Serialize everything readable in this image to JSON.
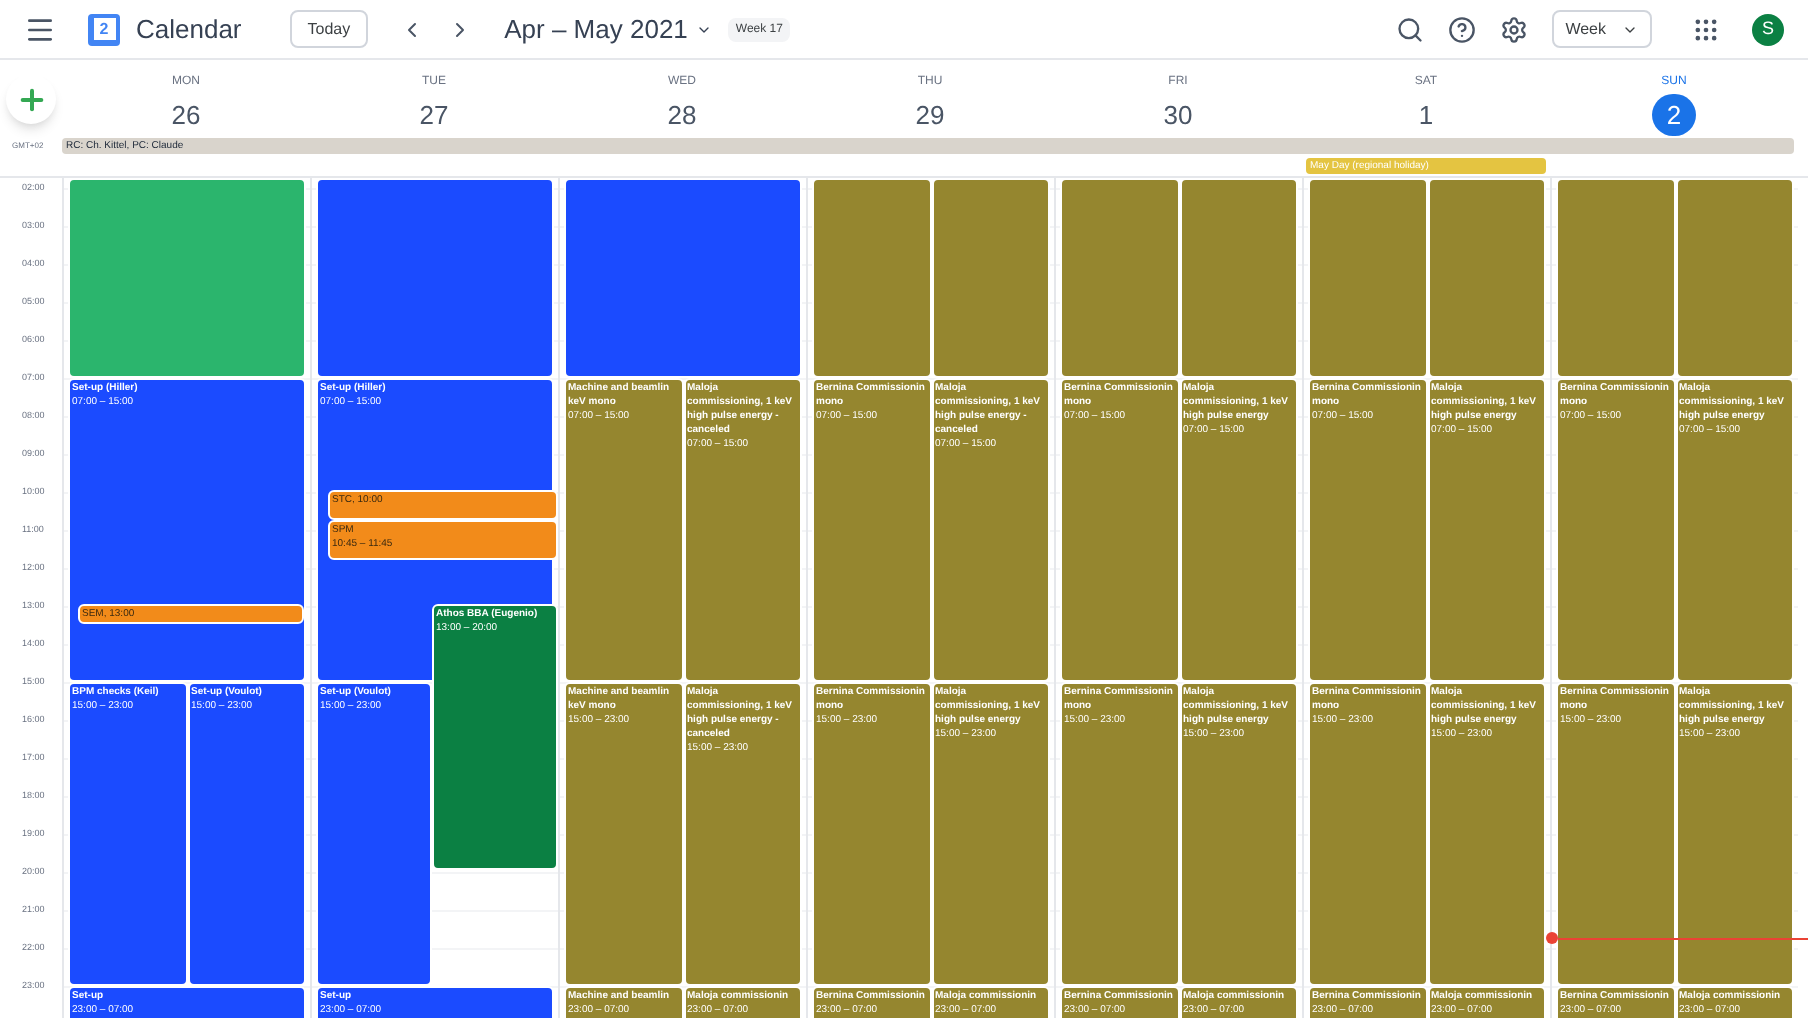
{
  "app": {
    "logo_digit": "2",
    "title": "Calendar"
  },
  "toolbar": {
    "today": "Today",
    "range": "Apr – May 2021",
    "week_badge": "Week 17",
    "view": "Week",
    "avatar": "S"
  },
  "timezone": "GMT+02",
  "days": [
    {
      "dow": "MON",
      "date": "26",
      "selected": false
    },
    {
      "dow": "TUE",
      "date": "27",
      "selected": false
    },
    {
      "dow": "WED",
      "date": "28",
      "selected": false
    },
    {
      "dow": "THU",
      "date": "29",
      "selected": false
    },
    {
      "dow": "FRI",
      "date": "30",
      "selected": false
    },
    {
      "dow": "SAT",
      "date": "1",
      "selected": false,
      "holiday": {
        "title": "May Day (regional holiday)",
        "color": "#e4c441"
      }
    },
    {
      "dow": "SUN",
      "date": "2",
      "selected": true
    }
  ],
  "all_day_banner": "RC: Ch. Kittel, PC: Claude",
  "hours": [
    "02:00",
    "03:00",
    "04:00",
    "05:00",
    "06:00",
    "07:00",
    "08:00",
    "09:00",
    "10:00",
    "11:00",
    "12:00",
    "13:00",
    "14:00",
    "15:00",
    "16:00",
    "17:00",
    "18:00",
    "19:00",
    "20:00",
    "21:00",
    "22:00",
    "23:00"
  ],
  "events": [
    [
      {
        "kind": "early",
        "color": "#2bb56d"
      },
      {
        "kind": "morning",
        "color": "#1b4bff",
        "lines": [
          "Set-up (Hiller)"
        ],
        "time": "07:00 – 15:00"
      },
      {
        "kind": "sem",
        "color": "#f28b1a",
        "lines": [
          "SEM, 13:00"
        ]
      },
      {
        "kind": "afternoon-left",
        "color": "#1b4bff",
        "lines": [
          "BPM checks (Keil)"
        ],
        "time": "15:00 – 23:00"
      },
      {
        "kind": "afternoon-right",
        "color": "#1b4bff",
        "lines": [
          "Set-up (Voulot)"
        ],
        "time": "15:00 – 23:00"
      },
      {
        "kind": "night",
        "color": "#1b4bff",
        "lines": [
          "Set-up"
        ],
        "time": "23:00 – 07:00"
      }
    ],
    [
      {
        "kind": "early",
        "color": "#1b4bff"
      },
      {
        "kind": "morning",
        "color": "#1b4bff",
        "lines": [
          "Set-up (Hiller)"
        ],
        "time": "07:00 – 15:00"
      },
      {
        "kind": "stc",
        "color": "#f28b1a",
        "lines": [
          "STC, 10:00"
        ]
      },
      {
        "kind": "spm",
        "color": "#f28b1a",
        "lines": [
          "SPM"
        ],
        "time": "10:45 – 11:45"
      },
      {
        "kind": "afternoon-narrow",
        "color": "#1b4bff",
        "lines": [
          "Set-up (Voulot)"
        ],
        "time": "15:00 – 23:00"
      },
      {
        "kind": "athos",
        "color": "#0b8043",
        "lines": [
          "Athos BBA (Eugenio)"
        ],
        "time": "13:00 – 20:00"
      },
      {
        "kind": "night",
        "color": "#1b4bff",
        "lines": [
          "Set-up"
        ],
        "time": "23:00 – 07:00"
      }
    ],
    [
      {
        "kind": "early",
        "color": "#1b4bff"
      },
      {
        "kind": "morning-left",
        "color": "#95862f",
        "lines": [
          "Machine and beamlin",
          "keV mono"
        ],
        "time": "07:00 – 15:00"
      },
      {
        "kind": "morning-right",
        "color": "#95862f",
        "lines": [
          "Maloja",
          "commissioning, 1 keV",
          "high pulse energy -",
          "canceled"
        ],
        "time": "07:00 – 15:00"
      },
      {
        "kind": "afternoon-left",
        "color": "#95862f",
        "lines": [
          "Machine and beamlin",
          "keV mono"
        ],
        "time": "15:00 – 23:00"
      },
      {
        "kind": "afternoon-right",
        "color": "#95862f",
        "lines": [
          "Maloja",
          "commissioning, 1 keV",
          "high pulse energy -",
          "canceled"
        ],
        "time": "15:00 – 23:00"
      },
      {
        "kind": "night-left",
        "color": "#95862f",
        "lines": [
          "Machine and beamlin"
        ],
        "time": "23:00 – 07:00"
      },
      {
        "kind": "night-right",
        "color": "#95862f",
        "lines": [
          "Maloja commissionin"
        ],
        "time": "23:00 – 07:00"
      }
    ],
    [
      {
        "kind": "early-left",
        "color": "#95862f"
      },
      {
        "kind": "early-right",
        "color": "#95862f"
      },
      {
        "kind": "morning-left",
        "color": "#95862f",
        "lines": [
          "Bernina Commissionin",
          "mono"
        ],
        "time": "07:00 – 15:00"
      },
      {
        "kind": "morning-right",
        "color": "#95862f",
        "lines": [
          "Maloja",
          "commissioning, 1 keV",
          "high pulse energy -",
          "canceled"
        ],
        "time": "07:00 – 15:00"
      },
      {
        "kind": "afternoon-left",
        "color": "#95862f",
        "lines": [
          "Bernina Commissionin",
          "mono"
        ],
        "time": "15:00 – 23:00"
      },
      {
        "kind": "afternoon-right",
        "color": "#95862f",
        "lines": [
          "Maloja",
          "commissioning, 1 keV",
          "high pulse energy"
        ],
        "time": "15:00 – 23:00"
      },
      {
        "kind": "night-left",
        "color": "#95862f",
        "lines": [
          "Bernina Commissionin"
        ],
        "time": "23:00 – 07:00"
      },
      {
        "kind": "night-right",
        "color": "#95862f",
        "lines": [
          "Maloja commissionin"
        ],
        "time": "23:00 – 07:00"
      }
    ],
    [
      {
        "kind": "early-left",
        "color": "#95862f"
      },
      {
        "kind": "early-right",
        "color": "#95862f"
      },
      {
        "kind": "morning-left",
        "color": "#95862f",
        "lines": [
          "Bernina Commissionin",
          "mono"
        ],
        "time": "07:00 – 15:00"
      },
      {
        "kind": "morning-right",
        "color": "#95862f",
        "lines": [
          "Maloja",
          "commissioning, 1 keV",
          "high pulse energy"
        ],
        "time": "07:00 – 15:00"
      },
      {
        "kind": "afternoon-left",
        "color": "#95862f",
        "lines": [
          "Bernina Commissionin",
          "mono"
        ],
        "time": "15:00 – 23:00"
      },
      {
        "kind": "afternoon-right",
        "color": "#95862f",
        "lines": [
          "Maloja",
          "commissioning, 1 keV",
          "high pulse energy"
        ],
        "time": "15:00 – 23:00"
      },
      {
        "kind": "night-left",
        "color": "#95862f",
        "lines": [
          "Bernina Commissionin"
        ],
        "time": "23:00 – 07:00"
      },
      {
        "kind": "night-right",
        "color": "#95862f",
        "lines": [
          "Maloja commissionin"
        ],
        "time": "23:00 – 07:00"
      }
    ],
    [
      {
        "kind": "early-left",
        "color": "#95862f"
      },
      {
        "kind": "early-right",
        "color": "#95862f"
      },
      {
        "kind": "morning-left",
        "color": "#95862f",
        "lines": [
          "Bernina Commissionin",
          "mono"
        ],
        "time": "07:00 – 15:00"
      },
      {
        "kind": "morning-right",
        "color": "#95862f",
        "lines": [
          "Maloja",
          "commissioning, 1 keV",
          "high pulse energy"
        ],
        "time": "07:00 – 15:00"
      },
      {
        "kind": "afternoon-left",
        "color": "#95862f",
        "lines": [
          "Bernina Commissionin",
          "mono"
        ],
        "time": "15:00 – 23:00"
      },
      {
        "kind": "afternoon-right",
        "color": "#95862f",
        "lines": [
          "Maloja",
          "commissioning, 1 keV",
          "high pulse energy"
        ],
        "time": "15:00 – 23:00"
      },
      {
        "kind": "night-left",
        "color": "#95862f",
        "lines": [
          "Bernina Commissionin"
        ],
        "time": "23:00 – 07:00"
      },
      {
        "kind": "night-right",
        "color": "#95862f",
        "lines": [
          "Maloja commissionin"
        ],
        "time": "23:00 – 07:00"
      }
    ],
    [
      {
        "kind": "early-left",
        "color": "#95862f"
      },
      {
        "kind": "early-right",
        "color": "#95862f"
      },
      {
        "kind": "morning-left",
        "color": "#95862f",
        "lines": [
          "Bernina Commissionin",
          "mono"
        ],
        "time": "07:00 – 15:00"
      },
      {
        "kind": "morning-right",
        "color": "#95862f",
        "lines": [
          "Maloja",
          "commissioning, 1 keV",
          "high pulse energy"
        ],
        "time": "07:00 – 15:00"
      },
      {
        "kind": "afternoon-left",
        "color": "#95862f",
        "lines": [
          "Bernina Commissionin",
          "mono"
        ],
        "time": "15:00 – 23:00"
      },
      {
        "kind": "afternoon-right",
        "color": "#95862f",
        "lines": [
          "Maloja",
          "commissioning, 1 keV",
          "high pulse energy"
        ],
        "time": "15:00 – 23:00"
      },
      {
        "kind": "night-left",
        "color": "#95862f",
        "lines": [
          "Bernina Commissionin"
        ],
        "time": "23:00 – 07:00"
      },
      {
        "kind": "night-right",
        "color": "#95862f",
        "lines": [
          "Maloja commissionin"
        ],
        "time": "23:00 – 07:00"
      }
    ]
  ]
}
